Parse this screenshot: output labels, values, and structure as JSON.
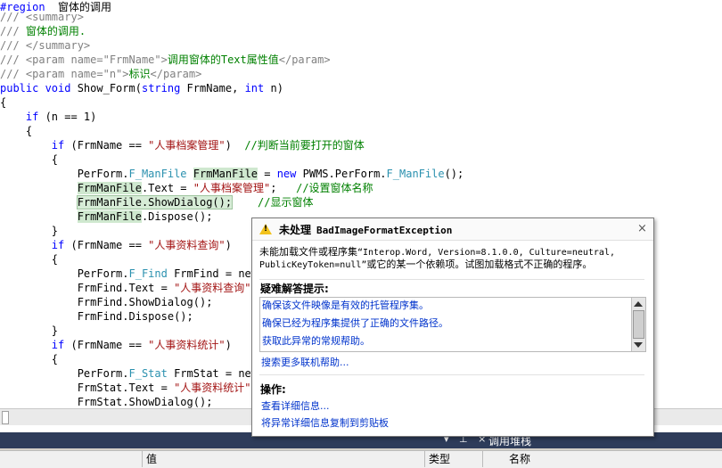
{
  "code_lines": [
    {
      "t": 0,
      "segments": [
        {
          "c": "kw",
          "v": "#region"
        },
        {
          "c": "",
          "v": "  窗体的调用"
        }
      ]
    },
    {
      "t": 11,
      "segments": [
        {
          "c": "gr",
          "v": "/// <summary>"
        }
      ]
    },
    {
      "t": 27,
      "segments": [
        {
          "c": "gr",
          "v": "/// "
        },
        {
          "c": "cm",
          "v": "窗体的调用."
        }
      ]
    },
    {
      "t": 43,
      "segments": [
        {
          "c": "gr",
          "v": "/// </summary>"
        }
      ]
    },
    {
      "t": 59,
      "segments": [
        {
          "c": "gr",
          "v": "/// <param name=\"FrmName\">"
        },
        {
          "c": "cm",
          "v": "调用窗体的Text属性值"
        },
        {
          "c": "gr",
          "v": "</param>"
        }
      ]
    },
    {
      "t": 75,
      "segments": [
        {
          "c": "gr",
          "v": "/// <param name=\"n\">"
        },
        {
          "c": "cm",
          "v": "标识"
        },
        {
          "c": "gr",
          "v": "</param>"
        }
      ]
    },
    {
      "t": 91,
      "segments": [
        {
          "c": "kw",
          "v": "public void"
        },
        {
          "c": "",
          "v": " Show_Form("
        },
        {
          "c": "kw",
          "v": "string"
        },
        {
          "c": "",
          "v": " FrmName, "
        },
        {
          "c": "kw",
          "v": "int"
        },
        {
          "c": "",
          "v": " n)"
        }
      ]
    },
    {
      "t": 107,
      "segments": [
        {
          "c": "",
          "v": "{"
        }
      ]
    },
    {
      "t": 123,
      "segments": [
        {
          "c": "",
          "v": "    "
        },
        {
          "c": "kw",
          "v": "if"
        },
        {
          "c": "",
          "v": " (n == 1)"
        }
      ]
    },
    {
      "t": 139,
      "segments": [
        {
          "c": "",
          "v": "    {"
        }
      ]
    },
    {
      "t": 155,
      "segments": [
        {
          "c": "",
          "v": "        "
        },
        {
          "c": "kw",
          "v": "if"
        },
        {
          "c": "",
          "v": " (FrmName == "
        },
        {
          "c": "st",
          "v": "\"人事档案管理\""
        },
        {
          "c": "",
          "v": ")  "
        },
        {
          "c": "cm",
          "v": "//判断当前要打开的窗体"
        }
      ]
    },
    {
      "t": 171,
      "segments": [
        {
          "c": "",
          "v": "        {"
        }
      ]
    },
    {
      "t": 187,
      "segments": [
        {
          "c": "",
          "v": "            PerForm."
        },
        {
          "c": "ty",
          "v": "F_ManFile"
        },
        {
          "c": "",
          "v": " "
        },
        {
          "c": "hl-green",
          "v": "FrmManFile"
        },
        {
          "c": "",
          "v": " = "
        },
        {
          "c": "kw",
          "v": "new"
        },
        {
          "c": "",
          "v": " PWMS.PerForm."
        },
        {
          "c": "ty",
          "v": "F_ManFile"
        },
        {
          "c": "",
          "v": "();"
        }
      ]
    },
    {
      "t": 203,
      "segments": [
        {
          "c": "",
          "v": "            "
        },
        {
          "c": "hl-green",
          "v": "FrmManFile"
        },
        {
          "c": "",
          "v": ".Text = "
        },
        {
          "c": "st",
          "v": "\"人事档案管理\""
        },
        {
          "c": "",
          "v": ";   "
        },
        {
          "c": "cm",
          "v": "//设置窗体名称"
        }
      ]
    },
    {
      "t": 219,
      "segments": [
        {
          "c": "",
          "v": "            "
        },
        {
          "c": "hl-box",
          "v": "FrmManFile.ShowDialog();"
        },
        {
          "c": "",
          "v": "    "
        },
        {
          "c": "cm",
          "v": "//显示窗体"
        }
      ]
    },
    {
      "t": 235,
      "segments": [
        {
          "c": "",
          "v": "            "
        },
        {
          "c": "hl-green",
          "v": "FrmManFile"
        },
        {
          "c": "",
          "v": ".Dispose();"
        }
      ]
    },
    {
      "t": 251,
      "segments": [
        {
          "c": "",
          "v": "        }"
        }
      ]
    },
    {
      "t": 267,
      "segments": [
        {
          "c": "",
          "v": "        "
        },
        {
          "c": "kw",
          "v": "if"
        },
        {
          "c": "",
          "v": " (FrmName == "
        },
        {
          "c": "st",
          "v": "\"人事资料查询\""
        },
        {
          "c": "",
          "v": ")"
        }
      ]
    },
    {
      "t": 283,
      "segments": [
        {
          "c": "",
          "v": "        {"
        }
      ]
    },
    {
      "t": 299,
      "segments": [
        {
          "c": "",
          "v": "            PerForm."
        },
        {
          "c": "ty",
          "v": "F_Find"
        },
        {
          "c": "",
          "v": " FrmFind = new"
        }
      ]
    },
    {
      "t": 315,
      "segments": [
        {
          "c": "",
          "v": "            FrmFind.Text = "
        },
        {
          "c": "st",
          "v": "\"人事资料查询\""
        }
      ]
    },
    {
      "t": 331,
      "segments": [
        {
          "c": "",
          "v": "            FrmFind.ShowDialog();"
        }
      ]
    },
    {
      "t": 347,
      "segments": [
        {
          "c": "",
          "v": "            FrmFind.Dispose();"
        }
      ]
    },
    {
      "t": 363,
      "segments": [
        {
          "c": "",
          "v": "        }"
        }
      ]
    },
    {
      "t": 379,
      "segments": [
        {
          "c": "",
          "v": "        "
        },
        {
          "c": "kw",
          "v": "if"
        },
        {
          "c": "",
          "v": " (FrmName == "
        },
        {
          "c": "st",
          "v": "\"人事资料统计\""
        },
        {
          "c": "",
          "v": ")"
        }
      ]
    },
    {
      "t": 395,
      "segments": [
        {
          "c": "",
          "v": "        {"
        }
      ]
    },
    {
      "t": 411,
      "segments": [
        {
          "c": "",
          "v": "            PerForm."
        },
        {
          "c": "ty",
          "v": "F_Stat"
        },
        {
          "c": "",
          "v": " FrmStat = new"
        }
      ]
    },
    {
      "t": 427,
      "segments": [
        {
          "c": "",
          "v": "            FrmStat.Text = "
        },
        {
          "c": "st",
          "v": "\"人事资料统计\""
        }
      ]
    },
    {
      "t": 443,
      "segments": [
        {
          "c": "",
          "v": "            FrmStat.ShowDialog();"
        }
      ]
    }
  ],
  "popup": {
    "title": "未处理",
    "exception": "BadImageFormatException",
    "close": "×",
    "message_prefix": "未能加载文件或程序集",
    "message_mono": "“Interop.Word, Version=8.1.0.0, Culture=neutral, PublicKeyToken=null”",
    "message_suffix": "或它的某一个依赖项。试图加载格式不正确的程序。",
    "tips_title": "疑难解答提示:",
    "tips": [
      "确保该文件映像是有效的托管程序集。",
      "确保已经为程序集提供了正确的文件路径。",
      "获取此异常的常规帮助。"
    ],
    "search_link": "搜索更多联机帮助...",
    "actions_title": "操作:",
    "actions": [
      "查看详细信息...",
      "将异常详细信息复制到剪贴板"
    ]
  },
  "dock": {
    "pin_buttons": "▾ ⊥ ×",
    "call_stack_title": "调用堆栈",
    "columns": [
      "值",
      "类型",
      "名称"
    ]
  }
}
